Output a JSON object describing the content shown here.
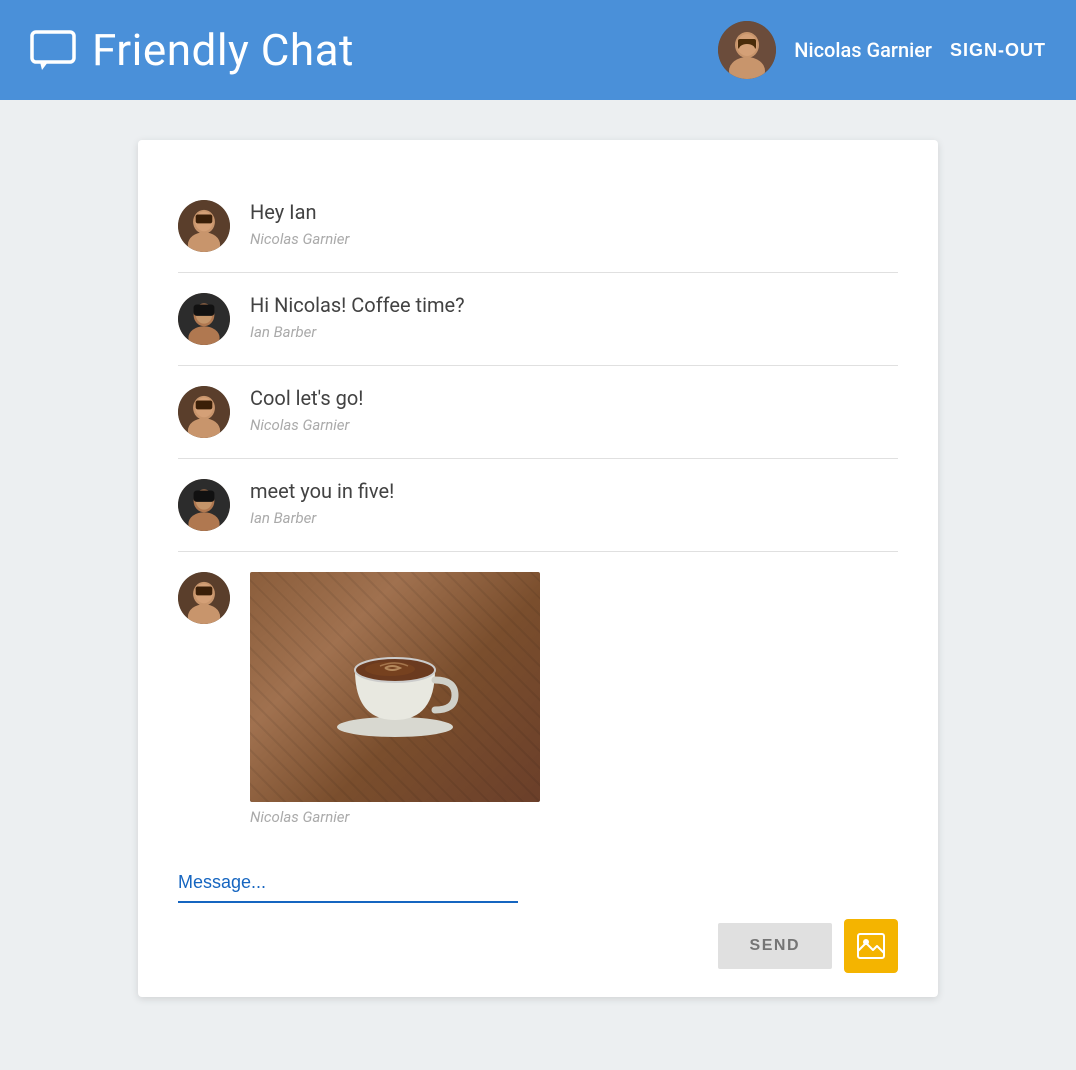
{
  "header": {
    "app_title": "Friendly Chat",
    "user_name": "Nicolas Garnier",
    "sign_out_label": "SIGN-OUT"
  },
  "messages": [
    {
      "id": 1,
      "text": "Hey Ian",
      "author": "Nicolas Garnier",
      "avatar_type": "nicolas",
      "has_image": false
    },
    {
      "id": 2,
      "text": "Hi Nicolas! Coffee time?",
      "author": "Ian Barber",
      "avatar_type": "ian",
      "has_image": false
    },
    {
      "id": 3,
      "text": "Cool let's go!",
      "author": "Nicolas Garnier",
      "avatar_type": "nicolas",
      "has_image": false
    },
    {
      "id": 4,
      "text": "meet you in five!",
      "author": "Ian Barber",
      "avatar_type": "ian",
      "has_image": false
    },
    {
      "id": 5,
      "text": "",
      "author": "Nicolas Garnier",
      "avatar_type": "nicolas",
      "has_image": true
    }
  ],
  "input": {
    "placeholder": "Message...",
    "send_label": "SEND"
  },
  "colors": {
    "header_bg": "#4a90d9",
    "accent": "#1565c0",
    "send_bg": "#e0e0e0",
    "image_upload_bg": "#f4b400"
  }
}
